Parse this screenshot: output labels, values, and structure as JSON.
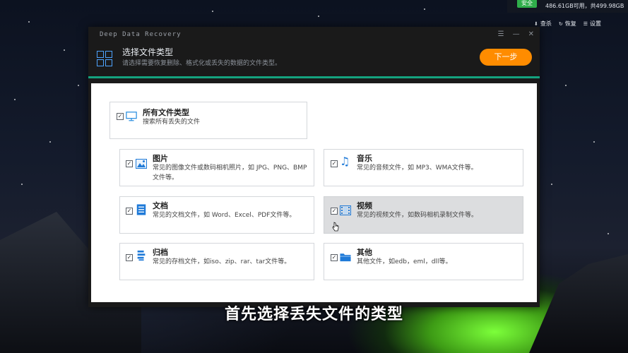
{
  "system": {
    "badge": "安全",
    "disk_info": "486.61GB可用，共499.98GB",
    "actions": [
      {
        "label": "查杀",
        "icon": "scan-icon"
      },
      {
        "label": "恢复",
        "icon": "restore-icon"
      },
      {
        "label": "设置",
        "icon": "settings-icon"
      }
    ]
  },
  "app": {
    "title": "Deep Data Recovery",
    "header": {
      "title": "选择文件类型",
      "subtitle": "请选择需要恢复删除、格式化或丢失的数据的文件类型。",
      "next_button": "下一步"
    },
    "all_types": {
      "title": "所有文件类型",
      "desc": "搜索所有丢失的文件",
      "checked": true
    },
    "types": [
      {
        "id": "images",
        "title": "图片",
        "desc": "常见的图像文件或数码相机照片，如 JPG、PNG、BMP文件等。",
        "checked": true
      },
      {
        "id": "music",
        "title": "音乐",
        "desc": "常见的音频文件，如 MP3、WMA文件等。",
        "checked": true
      },
      {
        "id": "documents",
        "title": "文档",
        "desc": "常见的文档文件，如 Word、Excel、PDF文件等。",
        "checked": true
      },
      {
        "id": "videos",
        "title": "视频",
        "desc": "常见的视频文件，如数码相机录制文件等。",
        "checked": true
      },
      {
        "id": "archives",
        "title": "归档",
        "desc": "常见的存档文件，如iso、zip、rar、tar文件等。",
        "checked": true
      },
      {
        "id": "others",
        "title": "其他",
        "desc": "其他文件，如edb，eml，dll等。",
        "checked": true
      }
    ]
  },
  "caption": "首先选择丢失文件的类型",
  "colors": {
    "accent_green": "#14a37f",
    "next_orange": "#ff8c00",
    "icon_blue": "#1f7ad8"
  }
}
